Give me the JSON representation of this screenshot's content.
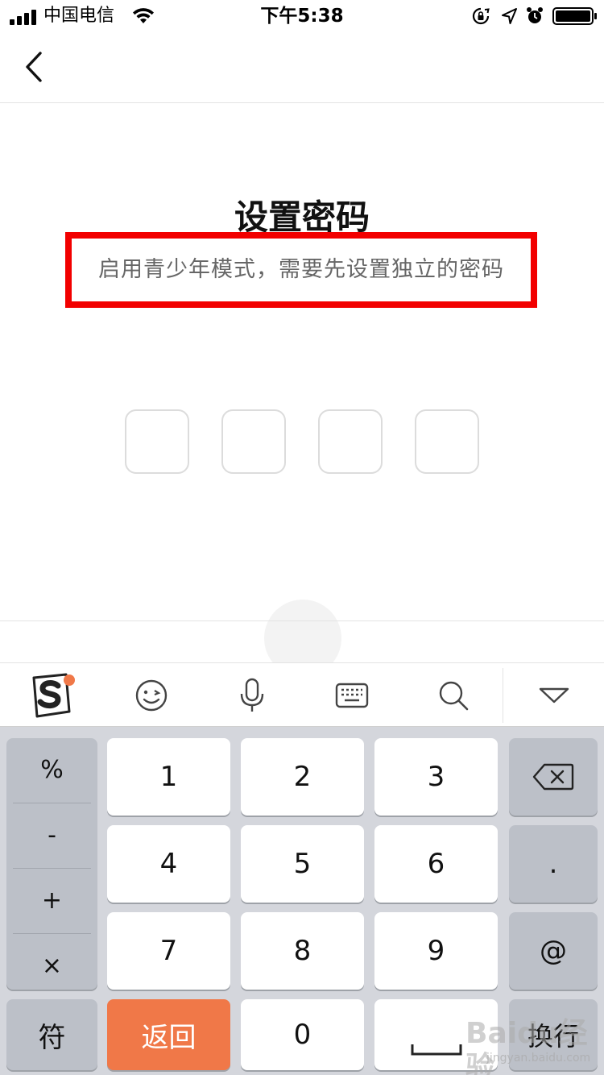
{
  "status_bar": {
    "carrier": "中国电信",
    "time": "下午5:38"
  },
  "page": {
    "title": "设置密码",
    "subtitle": "启用青少年模式，需要先设置独立的密码",
    "highlight_color": "#f20000"
  },
  "pin": {
    "length": 4
  },
  "toolbar": {
    "icons": [
      "sogou-logo-icon",
      "emoji-icon",
      "microphone-icon",
      "keyboard-icon",
      "search-icon",
      "collapse-keyboard-icon"
    ],
    "badge_color": "#f07848"
  },
  "keyboard": {
    "symbols": [
      "%",
      "-",
      "+",
      "×"
    ],
    "digits_row1": [
      "1",
      "2",
      "3"
    ],
    "digits_row2": [
      "4",
      "5",
      "6"
    ],
    "digits_row3": [
      "7",
      "8",
      "9"
    ],
    "dot": ".",
    "at": "@",
    "symbol_switch": "符",
    "back": "返回",
    "zero": "0",
    "enter": "换行",
    "accent_color": "#f07848"
  },
  "watermark": {
    "logo": "Baidu经验",
    "url": "jingyan.baidu.com"
  }
}
